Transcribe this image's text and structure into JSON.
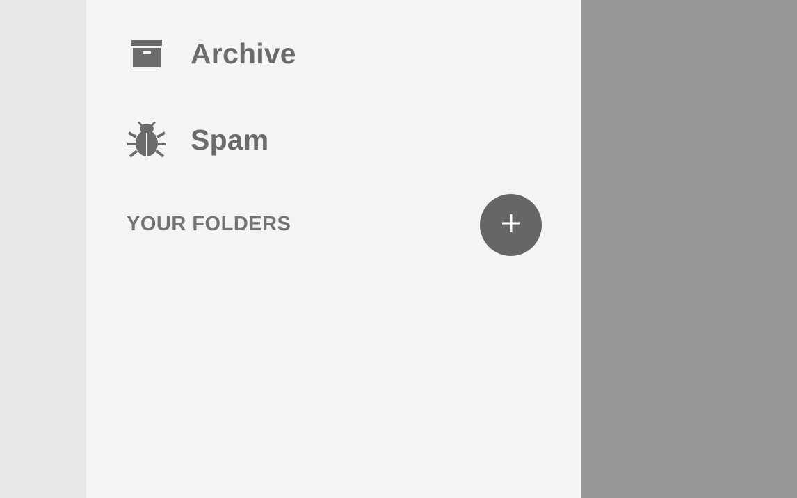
{
  "nav": {
    "items": [
      {
        "label": "Archive",
        "icon": "archive-icon"
      },
      {
        "label": "Spam",
        "icon": "bug-icon"
      }
    ]
  },
  "folders": {
    "header": "YOUR FOLDERS",
    "add_button_icon": "plus-icon"
  },
  "colors": {
    "drawer_background": "#f4f4f4",
    "scrim": "#979797",
    "icon": "#6b6b6b",
    "fab": "#666666"
  }
}
